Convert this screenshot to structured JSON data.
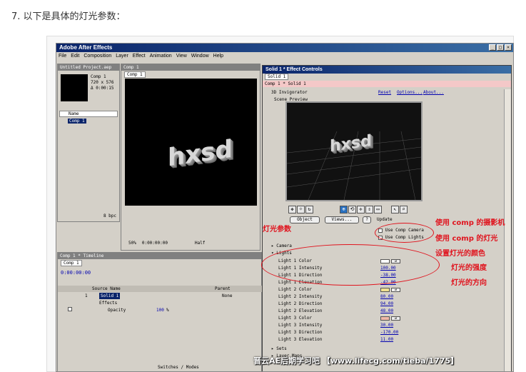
{
  "page": {
    "step_title": "7. 以下是具体的灯光参数："
  },
  "app": {
    "title": "Adobe After Effects",
    "menu": [
      "File",
      "Edit",
      "Composition",
      "Layer",
      "Effect",
      "Animation",
      "View",
      "Window",
      "Help"
    ],
    "window_buttons": [
      "_",
      "□",
      "×"
    ]
  },
  "project": {
    "title": "Untitled Project.aep",
    "comp_name": "Comp 1",
    "comp_size": "720 x 576",
    "comp_duration": "Δ 0:00:15",
    "col_name": "Name",
    "item": "Comp 1",
    "footer_bpc": "8 bpc"
  },
  "comp_window": {
    "title": "Comp 1",
    "tab": "Comp 1",
    "logo_text": "hxsd",
    "zoom": "50%",
    "time": "0:00:00:00",
    "res": "Half"
  },
  "timeline": {
    "title": "Comp 1 * Timeline",
    "tab": "Comp 1",
    "time": "0:00:00:00",
    "col_source": "Source Name",
    "col_parent": "Parent",
    "layer_num": "1",
    "layer_name": "Solid 1",
    "parent_value": "None",
    "effects": "Effects",
    "opacity": "Opacity",
    "opacity_value": "100",
    "opacity_unit": "%",
    "footer": "Switches / Modes"
  },
  "effect_controls": {
    "title": "Solid 1 * Effect Controls",
    "tab": "Solid 1",
    "subtitle": "Comp 1 * Solid 1",
    "effect_name": "3D Invigorator",
    "reset": "Reset",
    "options": "Options...",
    "about": "About...",
    "scene_preview": "Scene Preview",
    "preview_text": "hxsd",
    "object_btn": "Object",
    "views_btn": "Views...",
    "help_btn": "?",
    "update_btn": "Update",
    "use_comp_camera": "Use Comp Camera",
    "use_comp_lights": "Use Comp Lights",
    "camera": "Camera",
    "lights": "Lights",
    "rows": [
      {
        "label": "Light 1 Color",
        "value": "",
        "swatch": "#ffffff"
      },
      {
        "label": "Light 1 Intensity",
        "value": "100.00"
      },
      {
        "label": "Light 1 Direction",
        "value": "-38.00"
      },
      {
        "label": "Light 1 Elevation",
        "value": "-42.00"
      },
      {
        "label": "Light 2 Color",
        "value": "",
        "swatch": "#f0e090"
      },
      {
        "label": "Light 2 Intensity",
        "value": "80.00"
      },
      {
        "label": "Light 2 Direction",
        "value": "94.00"
      },
      {
        "label": "Light 2 Elevation",
        "value": "48.00"
      },
      {
        "label": "Light 3 Color",
        "value": "",
        "swatch": "#f0b8a8"
      },
      {
        "label": "Light 3 Intensity",
        "value": "30.00"
      },
      {
        "label": "Light 3 Direction",
        "value": "-170.00"
      },
      {
        "label": "Light 3 Elevation",
        "value": "11.00"
      }
    ],
    "sets": "Sets",
    "layer_maps": "Layer Maps"
  },
  "annotations": {
    "light_params": "灯光参数",
    "use_comp_camera": "使用 comp 的摄影机",
    "use_comp_light": "使用 comp 的灯光",
    "color": "设置灯光的颜色",
    "intensity": "灯光的强度",
    "direction": "灯光的方向"
  },
  "watermark": "晋云AE后期学习吧 【www.lifecg.com/tieba/1775】",
  "colors": {
    "titlebar": "#0a246a",
    "annotation": "#e0141e",
    "link_value": "#0000b0",
    "subtitle_bg": "#f4c8c8"
  }
}
